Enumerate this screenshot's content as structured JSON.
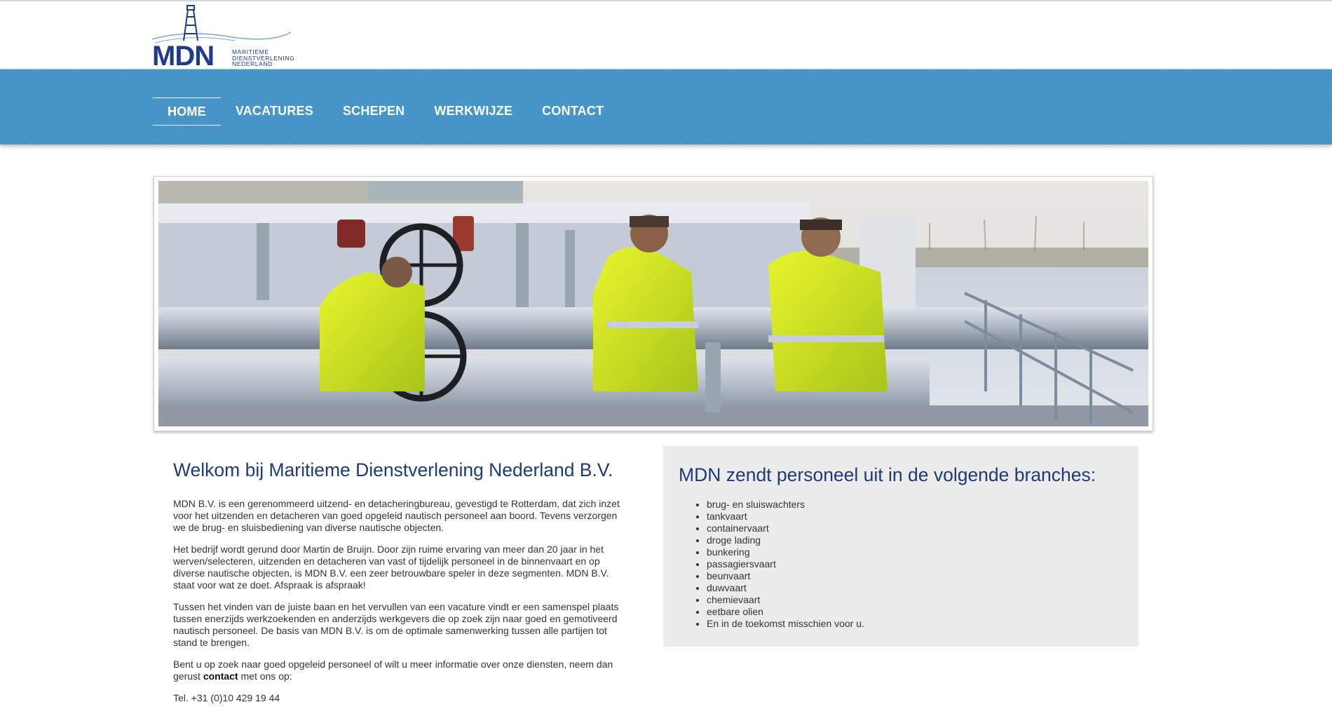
{
  "brand": {
    "logo_text": "MDN",
    "logo_subtitle": [
      "Maritieme",
      "Dienstverlening",
      "Nederland"
    ]
  },
  "nav": {
    "items": [
      {
        "label": "HOME",
        "active": true
      },
      {
        "label": "VACATURES"
      },
      {
        "label": "SCHEPEN"
      },
      {
        "label": "WERKWIJZE"
      },
      {
        "label": "CONTACT"
      }
    ]
  },
  "hero": {
    "image": "photo-crew-on-tanker-deck"
  },
  "welcome": {
    "title": "Welkom bij Maritieme Dienstverlening Nederland B.V.",
    "p1": "MDN B.V. is een gerenommeerd uitzend- en detacheringbureau, gevestigd te Rotterdam, dat zich inzet voor het uitzenden en detacheren van goed opgeleid nautisch personeel aan boord. Tevens verzorgen we de brug- en sluisbediening van diverse nautische objecten.",
    "p2": "Het bedrijf wordt gerund door Martin de Bruijn. Door zijn ruime ervaring van meer dan 20 jaar in het werven/selecteren, uitzenden en  detacheren van vast of tijdelijk personeel in de binnenvaart en op diverse nautische objecten, is MDN B.V. een zeer betrouwbare speler in deze segmenten. MDN B.V. staat voor wat ze doet. Afspraak is afspraak!",
    "p3": "Tussen het vinden van de juiste baan en het vervullen van een vacature vindt er een samenspel plaats tussen enerzijds werkzoekenden en anderzijds werkgevers die op zoek zijn naar goed en gemotiveerd nautisch personeel. De basis van MDN B.V. is om de optimale samenwerking tussen alle partijen tot stand te brengen.",
    "p4_before": "Bent u op zoek naar goed opgeleid personeel of wilt u meer informatie over onze diensten, neem dan gerust ",
    "p4_link": "contact",
    "p4_after": " met ons op:",
    "phone": "Tel. +31 (0)10 429 19 44"
  },
  "branches": {
    "title": "MDN zendt personeel uit in de volgende branches:",
    "items": [
      "brug- en sluiswachters",
      "tankvaart",
      "containervaart",
      "droge lading",
      "bunkering",
      "passagiersvaart",
      "beunvaart",
      "duwvaart",
      "chemievaart",
      "eetbare olien",
      "En in de toekomst misschien voor u."
    ]
  },
  "colors": {
    "nav_bg": "#4192c6",
    "brand_blue": "#1e3a7b",
    "box_bg": "#ececec"
  }
}
